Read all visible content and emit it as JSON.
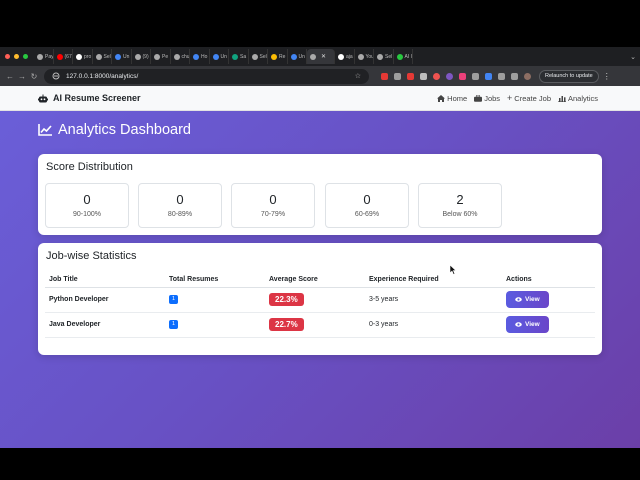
{
  "browser": {
    "colors": {
      "close": "#ff5f57",
      "minimize": "#febc2e",
      "maximize": "#28c840"
    },
    "tabs": [
      {
        "label": "Pay",
        "color": "#aaaaaa"
      },
      {
        "label": "(67",
        "color": "#ff0000"
      },
      {
        "label": "pro",
        "color": "#ffffff"
      },
      {
        "label": "Sel",
        "color": "#aaaaaa"
      },
      {
        "label": "Un",
        "color": "#4285f4"
      },
      {
        "label": "(9)",
        "color": "#aaaaaa"
      },
      {
        "label": "Pe",
        "color": "#aaaaaa"
      },
      {
        "label": "chu",
        "color": "#aaaaaa"
      },
      {
        "label": "Ho",
        "color": "#4285f4"
      },
      {
        "label": "Un",
        "color": "#4285f4"
      },
      {
        "label": "Sa",
        "color": "#10a37f"
      },
      {
        "label": "Sel",
        "color": "#aaaaaa"
      },
      {
        "label": "Re",
        "color": "#fbbc04"
      },
      {
        "label": "Un",
        "color": "#4285f4"
      },
      {
        "label": "",
        "color": "#aaaaaa",
        "active": true
      },
      {
        "label": "aja",
        "color": "#ffffff"
      },
      {
        "label": "You",
        "color": "#aaaaaa"
      },
      {
        "label": "Sel",
        "color": "#aaaaaa"
      },
      {
        "label": "AI I",
        "color": "#28c840"
      }
    ],
    "url": "127.0.0.1:8000/analytics/",
    "relaunch_label": "Relaunch to update"
  },
  "app": {
    "brand": "AI Resume Screener",
    "nav": {
      "home": "Home",
      "jobs": "Jobs",
      "create_job": "Create Job",
      "analytics": "Analytics"
    },
    "page_title": "Analytics Dashboard",
    "score_distribution": {
      "title": "Score Distribution",
      "buckets": [
        {
          "count": "0",
          "label": "90-100%"
        },
        {
          "count": "0",
          "label": "80-89%"
        },
        {
          "count": "0",
          "label": "70-79%"
        },
        {
          "count": "0",
          "label": "60-69%"
        },
        {
          "count": "2",
          "label": "Below 60%"
        }
      ]
    },
    "job_stats": {
      "title": "Job-wise Statistics",
      "columns": [
        "Job Title",
        "Total Resumes",
        "Average Score",
        "Experience Required",
        "Actions"
      ],
      "rows": [
        {
          "title": "Python Developer",
          "total": "1",
          "avg_score": "22.3%",
          "experience": "3-5 years",
          "action": "View"
        },
        {
          "title": "Java Developer",
          "total": "1",
          "avg_score": "22.7%",
          "experience": "0-3 years",
          "action": "View"
        }
      ]
    }
  }
}
